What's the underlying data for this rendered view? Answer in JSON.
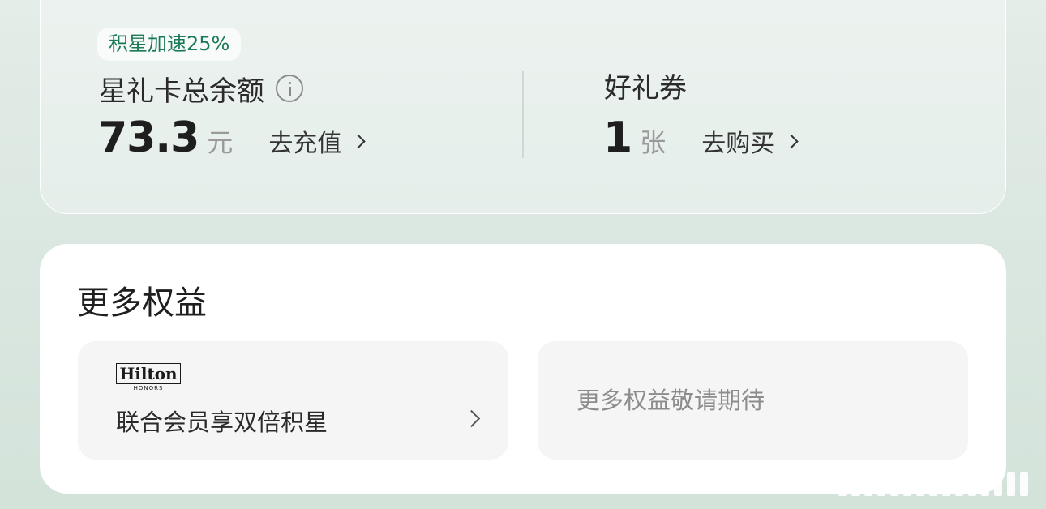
{
  "wallet": {
    "promo_tag": "积星加速25%",
    "balance_label": "星礼卡总余额",
    "balance_value": "73.3",
    "balance_unit": "元",
    "recharge_label": "去充值",
    "coupon_label": "好礼券",
    "coupon_value": "1",
    "coupon_unit": "张",
    "buy_label": "去购买"
  },
  "benefits": {
    "title": "更多权益",
    "hilton_logo_text": "Hilton",
    "hilton_logo_sub": "HONORS",
    "hilton_text": "联合会员享双倍积星",
    "placeholder_text": "更多权益敬请期待"
  },
  "colors": {
    "accent_green": "#1a7a56",
    "background": "#dbe7e1"
  }
}
